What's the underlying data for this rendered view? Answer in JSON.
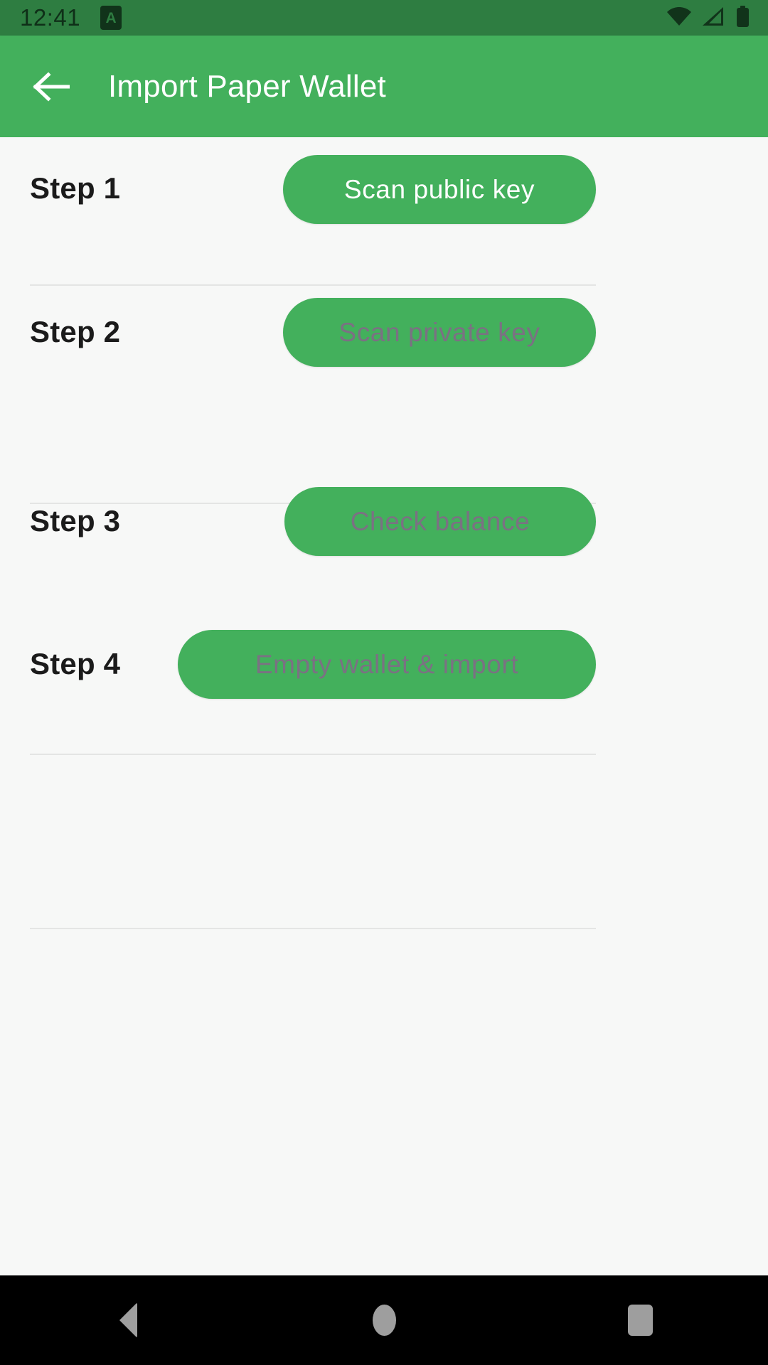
{
  "status_bar": {
    "time": "12:41",
    "notification_icon_letter": "A",
    "icons": [
      "wifi-icon",
      "cellular-signal-icon",
      "battery-icon"
    ],
    "background_color": "#2E7D41",
    "foreground_color": "#0F2F18"
  },
  "app_bar": {
    "title": "Import Paper Wallet",
    "back_icon": "arrow-left-icon",
    "background_color": "#43B05C",
    "title_color": "#FFFFFF"
  },
  "theme": {
    "accent_color": "#43B05C",
    "page_background": "#F7F8F7",
    "divider_color": "#E4E5E4",
    "label_color": "#1B1B1B",
    "disabled_text_color": "#7B7183",
    "enabled_text_color": "#FFFFFF"
  },
  "steps": [
    {
      "label": "Step 1",
      "button_label": "Scan public key",
      "enabled": true
    },
    {
      "label": "Step 2",
      "button_label": "Scan private key",
      "enabled": false
    },
    {
      "label": "Step 3",
      "button_label": "Check balance",
      "enabled": false
    },
    {
      "label": "Step 4",
      "button_label": "Empty wallet & import",
      "enabled": false
    }
  ],
  "nav_bar": {
    "background_color": "#000000",
    "buttons": [
      "back-nav-button",
      "home-nav-button",
      "recents-nav-button"
    ]
  }
}
